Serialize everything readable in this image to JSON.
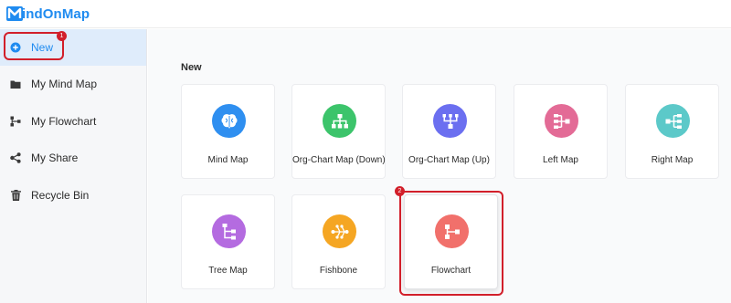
{
  "app": {
    "logo_text": "indOnMap",
    "logo_letter": "M",
    "brand_color": "#1f8bf0"
  },
  "sidebar": {
    "items": [
      {
        "label": "New",
        "icon": "plus-circle-icon",
        "active": true
      },
      {
        "label": "My Mind Map",
        "icon": "folder-icon",
        "active": false
      },
      {
        "label": "My Flowchart",
        "icon": "flowchart-icon",
        "active": false
      },
      {
        "label": "My Share",
        "icon": "share-icon",
        "active": false
      },
      {
        "label": "Recycle Bin",
        "icon": "trash-icon",
        "active": false
      }
    ]
  },
  "main": {
    "section_title": "New",
    "cards": [
      {
        "label": "Mind Map",
        "icon": "brain-icon",
        "color": "#2f8ff0"
      },
      {
        "label": "Org-Chart Map (Down)",
        "icon": "org-chart-down-icon",
        "color": "#3cc46b"
      },
      {
        "label": "Org-Chart Map (Up)",
        "icon": "org-chart-up-icon",
        "color": "#6b6ff0"
      },
      {
        "label": "Left Map",
        "icon": "left-map-icon",
        "color": "#e36b96"
      },
      {
        "label": "Right Map",
        "icon": "right-map-icon",
        "color": "#5cc9c9"
      },
      {
        "label": "Tree Map",
        "icon": "tree-map-icon",
        "color": "#b46be0"
      },
      {
        "label": "Fishbone",
        "icon": "fishbone-icon",
        "color": "#f5a623"
      },
      {
        "label": "Flowchart",
        "icon": "flowchart-icon",
        "color": "#f1706b"
      }
    ]
  },
  "annotations": {
    "step_1": "1",
    "step_2": "2",
    "highlight_color": "#d21f2a"
  }
}
